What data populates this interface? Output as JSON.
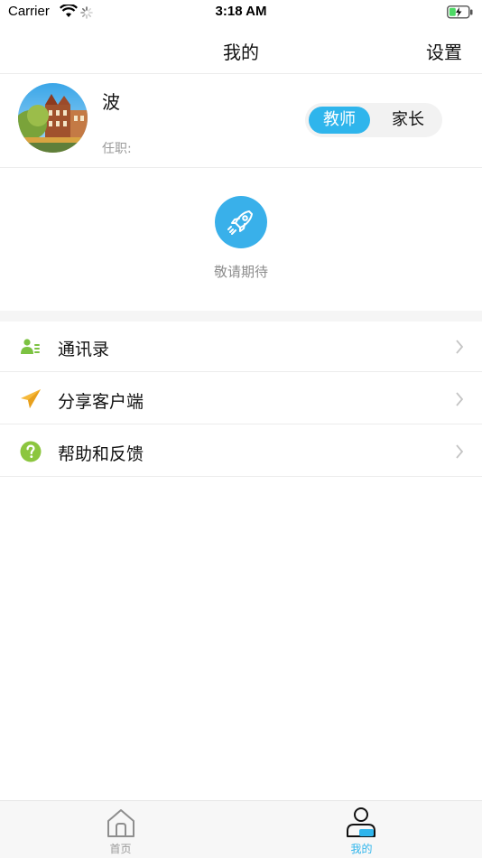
{
  "status_bar": {
    "carrier": "Carrier",
    "time": "3:18 AM"
  },
  "nav": {
    "title": "我的",
    "settings_label": "设置"
  },
  "profile": {
    "name": "波",
    "position_label": "任职:",
    "roles": [
      {
        "label": "教师",
        "selected": true
      },
      {
        "label": "家长",
        "selected": false
      }
    ]
  },
  "coming_soon": {
    "icon": "rocket-icon",
    "label": "敬请期待"
  },
  "menu": [
    {
      "label": "通讯录",
      "icon": "contacts-icon"
    },
    {
      "label": "分享客户端",
      "icon": "paper-plane-icon"
    },
    {
      "label": "帮助和反馈",
      "icon": "help-icon"
    }
  ],
  "tabs": [
    {
      "label": "首页",
      "icon": "home-icon",
      "active": false
    },
    {
      "label": "我的",
      "icon": "profile-icon",
      "active": true
    }
  ],
  "colors": {
    "accent": "#2fb5ec",
    "rocket_bg": "#39b0ea",
    "contacts_green": "#7cc242",
    "share_orange": "#f6b93b",
    "help_green": "#8cc63f"
  }
}
